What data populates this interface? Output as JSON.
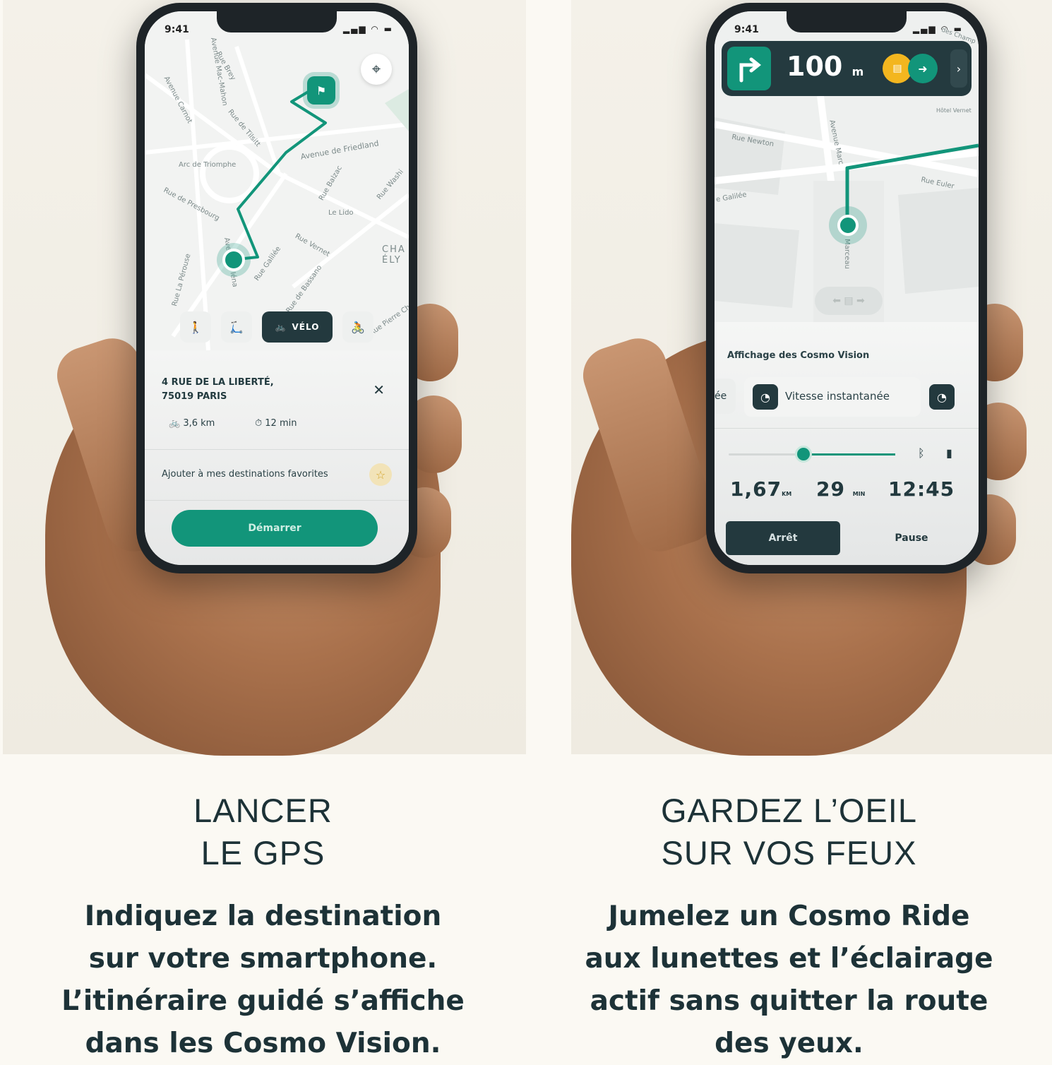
{
  "colors": {
    "accent": "#12957a",
    "dark": "#23393e",
    "background": "#fbf9f3",
    "text": "#1d3237"
  },
  "left": {
    "status": {
      "time": "9:41"
    },
    "map": {
      "streets": [
        "Avenue Mac-Mahon",
        "Rue Brey",
        "Avenue Carnot",
        "Rue de Tilsitt",
        "Arc de Triomphe",
        "Avenue de Friedland",
        "Rue Balzac",
        "Rue Washi",
        "Rue de Presbourg",
        "Le Lido",
        "Rue Vernet",
        "Avenue d'Iéna",
        "Rue Galilée",
        "Rue La Pérouse",
        "Rue de Bassano",
        "CHA ÉLY",
        "Rue Pierre Ch"
      ],
      "icons": {
        "locate": "crosshair-icon",
        "destination": "flag-icon"
      }
    },
    "modes": {
      "walk": "walk-icon",
      "scooter": "scooter-icon",
      "bike_active": "VÉLO",
      "ebike": "bike-icon"
    },
    "destination": {
      "line1": "4 RUE DE LA LIBERTÉ,",
      "line2": "75019 PARIS"
    },
    "stats": {
      "distance": "3,6 km",
      "duration": "12 min"
    },
    "favorite_label": "Ajouter à mes destinations favorites",
    "start_label": "Démarrer",
    "caption": {
      "title_lines": [
        "LANCER",
        "LE GPS"
      ],
      "body_lines": [
        "Indiquez la destination",
        "sur votre smartphone.",
        "L’itinéraire guidé s’affiche",
        "dans les Cosmo Vision."
      ]
    }
  },
  "right": {
    "status": {
      "time": "9:41"
    },
    "nav": {
      "distance": "100",
      "unit": "m"
    },
    "map": {
      "streets": [
        "Rue Newton",
        "Avenue Marc",
        "Rue Euler",
        "e Galilée",
        "Marceau",
        "Hôtel Vernet",
        "des Champ"
      ]
    },
    "vision_label": "Affichage des Cosmo Vision",
    "vision_left_partial": "ée",
    "vision_option": "Vitesse instantanée",
    "stats": {
      "km": "1,67",
      "km_unit": "KM",
      "min": "29",
      "min_unit": "MIN",
      "time": "12:45"
    },
    "stop_label": "Arrêt",
    "pause_label": "Pause",
    "caption": {
      "title_lines": [
        "GARDEZ L’OEIL",
        "SUR VOS FEUX"
      ],
      "body_lines": [
        "Jumelez un Cosmo Ride",
        "aux lunettes et l’éclairage",
        "actif sans quitter la route",
        "des yeux."
      ]
    }
  }
}
